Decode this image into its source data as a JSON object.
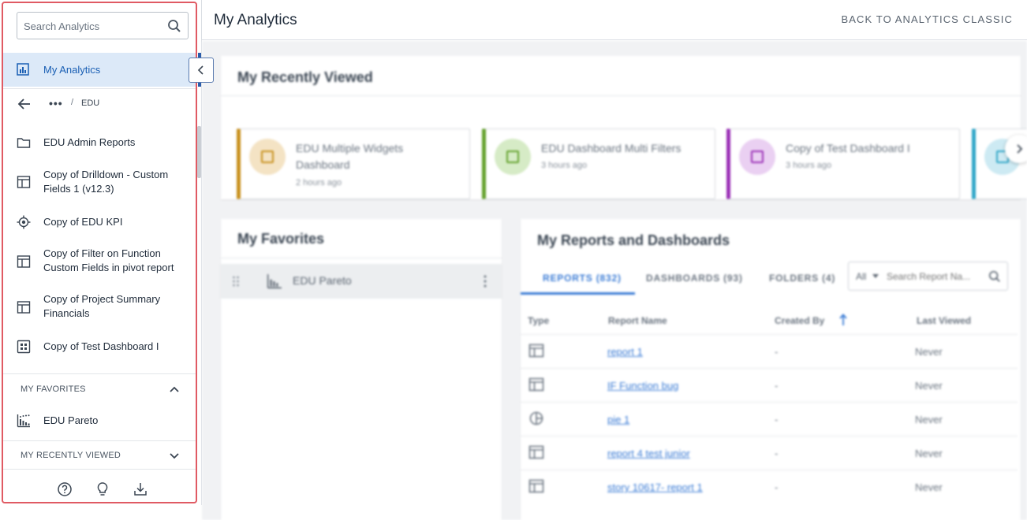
{
  "sidebar": {
    "search_placeholder": "Search Analytics",
    "nav_my_analytics": "My Analytics",
    "breadcrumb": {
      "ellipsis": "•••",
      "separator": "/",
      "current": "EDU"
    },
    "tree_items": [
      {
        "label": "EDU Admin Reports",
        "icon": "folder-icon"
      },
      {
        "label": "Copy of Drilldown - Custom Fields 1 (v12.3)",
        "icon": "table-report-icon"
      },
      {
        "label": "Copy of EDU KPI",
        "icon": "kpi-target-icon"
      },
      {
        "label": "Copy of Filter on Function Custom Fields in pivot report",
        "icon": "table-report-icon"
      },
      {
        "label": "Copy of Project Summary Financials",
        "icon": "table-report-icon"
      },
      {
        "label": "Copy of Test Dashboard I",
        "icon": "dashboard-grid-icon"
      }
    ],
    "my_favorites_header": "MY FAVORITES",
    "favorites": [
      {
        "label": "EDU Pareto",
        "icon": "pareto-chart-icon"
      }
    ],
    "my_recently_viewed_header": "MY RECENTLY VIEWED",
    "footer_icons": [
      "help-icon",
      "lightbulb-icon",
      "download-icon"
    ]
  },
  "header": {
    "title": "My Analytics",
    "back_link": "BACK TO ANALYTICS CLASSIC"
  },
  "recently_viewed": {
    "title": "My Recently Viewed",
    "cards": [
      {
        "name": "EDU Multiple Widgets Dashboard",
        "time": "2 hours ago",
        "color": "#c8901c",
        "bg": "#f4e3c4"
      },
      {
        "name": "EDU Dashboard Multi Filters",
        "time": "3 hours ago",
        "color": "#62a02a",
        "bg": "#d6ebc6"
      },
      {
        "name": "Copy of Test Dashboard I",
        "time": "3 hours ago",
        "color": "#9a2fb6",
        "bg": "#ead0f2"
      },
      {
        "name": "",
        "time": "",
        "color": "#2fa6c8",
        "bg": "#cdeaf3"
      }
    ]
  },
  "favorites_panel": {
    "title": "My Favorites",
    "items": [
      {
        "label": "EDU Pareto"
      }
    ]
  },
  "reports_panel": {
    "title": "My Reports and Dashboards",
    "tabs": [
      "REPORTS (832)",
      "DASHBOARDS (93)",
      "FOLDERS (4)"
    ],
    "filter_value": "All",
    "search_placeholder": "Search Report Na...",
    "columns": [
      "Type",
      "Report Name",
      "Created By",
      "Last Viewed"
    ],
    "rows": [
      {
        "icon": "table-report-icon",
        "name": "report 1",
        "created_by": "-",
        "last_viewed": "Never"
      },
      {
        "icon": "table-report-icon",
        "name": "IF Function bug",
        "created_by": "-",
        "last_viewed": "Never"
      },
      {
        "icon": "pie-chart-icon",
        "name": "pie 1",
        "created_by": "-",
        "last_viewed": "Never"
      },
      {
        "icon": "table-report-icon",
        "name": "report 4 test junior",
        "created_by": "-",
        "last_viewed": "Never"
      },
      {
        "icon": "table-report-icon",
        "name": "story 10617- report 1",
        "created_by": "-",
        "last_viewed": "Never"
      }
    ]
  }
}
